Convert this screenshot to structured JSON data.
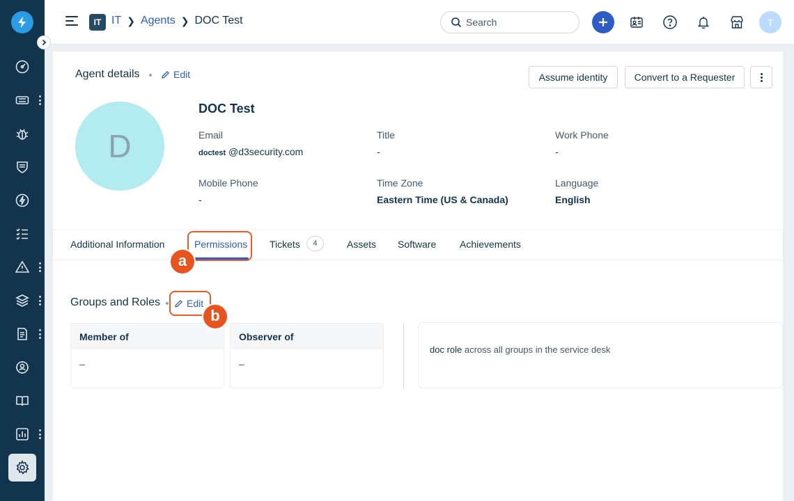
{
  "app": {
    "workspace_badge": "IT",
    "breadcrumb": [
      "IT",
      "Agents",
      "DOC Test"
    ],
    "search_placeholder": "Search",
    "user_initial": "T"
  },
  "sidebar": {
    "items": [
      {
        "icon": "dashboard-icon"
      },
      {
        "icon": "tickets-icon",
        "has_more": true
      },
      {
        "icon": "bug-icon"
      },
      {
        "icon": "shield-icon"
      },
      {
        "icon": "lightning-icon"
      },
      {
        "icon": "checklist-icon"
      },
      {
        "icon": "alert-icon",
        "has_more": true
      },
      {
        "icon": "layers-icon",
        "has_more": true
      },
      {
        "icon": "document-icon",
        "has_more": true
      },
      {
        "icon": "network-icon"
      },
      {
        "icon": "book-icon"
      },
      {
        "icon": "reports-icon",
        "has_more": true
      },
      {
        "icon": "settings-icon",
        "active": true
      }
    ]
  },
  "agent": {
    "section_title": "Agent details",
    "edit_label": "Edit",
    "assume_identity_label": "Assume identity",
    "convert_label": "Convert to a Requester",
    "avatar_letter": "D",
    "name": "DOC Test",
    "fields": {
      "email_label": "Email",
      "email_user": "doctest",
      "email_domain": "@d3security.com",
      "title_label": "Title",
      "title_value": "-",
      "work_phone_label": "Work Phone",
      "work_phone_value": "-",
      "mobile_label": "Mobile Phone",
      "mobile_value": "-",
      "timezone_label": "Time Zone",
      "timezone_value": "Eastern Time (US & Canada)",
      "language_label": "Language",
      "language_value": "English"
    }
  },
  "tabs": {
    "additional": "Additional Information",
    "permissions": "Permissions",
    "tickets": "Tickets",
    "tickets_count": "4",
    "assets": "Assets",
    "software": "Software",
    "achievements": "Achievements"
  },
  "groups": {
    "title": "Groups and Roles",
    "edit_label": "Edit",
    "member_header": "Member of",
    "member_value": "–",
    "observer_header": "Observer of",
    "observer_value": "–",
    "role_name": "doc role",
    "role_scope": " across all groups in the service desk"
  },
  "annotations": {
    "marker_a": "a",
    "marker_b": "b"
  },
  "colors": {
    "sidebar_bg": "#12344d",
    "accent": "#2c5cc5",
    "annotation": "#e8541f",
    "avatar_bg": "#b2ebf0"
  }
}
